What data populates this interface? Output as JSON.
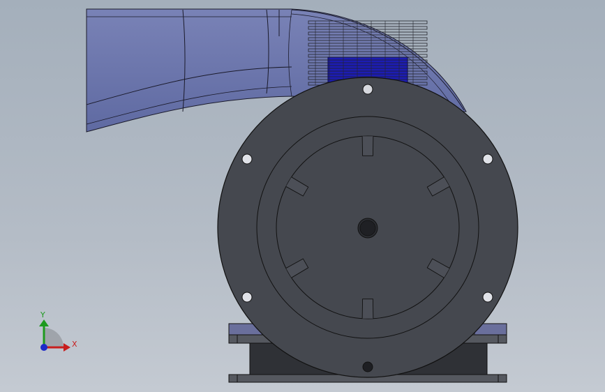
{
  "viewport": {
    "background_top": "#a4afbb",
    "background_bottom": "#c4cad2"
  },
  "model": {
    "body_color": "#45484f",
    "edge_color": "#111111",
    "duct_color": "#6f79ad",
    "fan_block_color": "#1c1cb4"
  },
  "triad": {
    "x_label": "X",
    "y_label": "Y",
    "x_color": "#c81e1e",
    "y_color": "#1e9a1e",
    "z_color": "#1e2ac8"
  }
}
